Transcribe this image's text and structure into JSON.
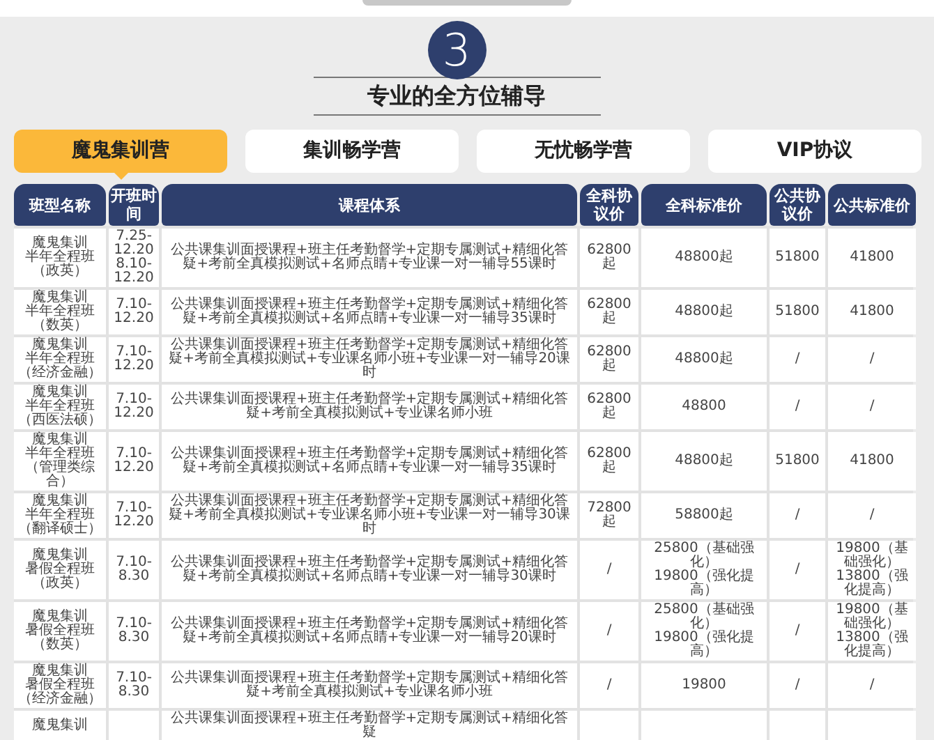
{
  "step_number": "3",
  "section_title": "专业的全方位辅导",
  "tabs": [
    {
      "label": "魔鬼集训营",
      "selected": true
    },
    {
      "label": "集训畅学营",
      "selected": false
    },
    {
      "label": "无忧畅学营",
      "selected": false
    },
    {
      "label": "VIP协议",
      "selected": false
    }
  ],
  "table": {
    "columns": [
      "班型名称",
      "开班时间",
      "课程体系",
      "全科协议价",
      "全科标准价",
      "公共协议价",
      "公共标准价"
    ],
    "rows": [
      {
        "name": [
          "魔鬼集训",
          "半年全程班（政英）"
        ],
        "dates": [
          "7.25-12.20",
          "8.10-12.20"
        ],
        "course": "公共课集训面授课程+班主任考勤督学+定期专属测试+精细化答疑+考前全真模拟测试+名师点睛+专业课一对一辅导55课时",
        "full_agreement": [
          "62800起"
        ],
        "full_standard": [
          "48800起"
        ],
        "public_agreement": [
          "51800"
        ],
        "public_standard": [
          "41800"
        ]
      },
      {
        "name": [
          "魔鬼集训",
          "半年全程班（数英）"
        ],
        "dates": [
          "7.10-12.20"
        ],
        "course": "公共课集训面授课程+班主任考勤督学+定期专属测试+精细化答疑+考前全真模拟测试+名师点睛+专业课一对一辅导35课时",
        "full_agreement": [
          "62800起"
        ],
        "full_standard": [
          "48800起"
        ],
        "public_agreement": [
          "51800"
        ],
        "public_standard": [
          "41800"
        ]
      },
      {
        "name": [
          "魔鬼集训",
          "半年全程班（经济金融）"
        ],
        "dates": [
          "7.10-12.20"
        ],
        "course": "公共课集训面授课程+班主任考勤督学+定期专属测试+精细化答疑+考前全真模拟测试+专业课名师小班+专业课一对一辅导20课时",
        "full_agreement": [
          "62800起"
        ],
        "full_standard": [
          "48800起"
        ],
        "public_agreement": [
          "/"
        ],
        "public_standard": [
          "/"
        ]
      },
      {
        "name": [
          "魔鬼集训",
          "半年全程班（西医法硕）"
        ],
        "dates": [
          "7.10-12.20"
        ],
        "course": "公共课集训面授课程+班主任考勤督学+定期专属测试+精细化答疑+考前全真模拟测试+专业课名师小班",
        "full_agreement": [
          "62800起"
        ],
        "full_standard": [
          "48800"
        ],
        "public_agreement": [
          "/"
        ],
        "public_standard": [
          "/"
        ]
      },
      {
        "name": [
          "魔鬼集训",
          "半年全程班（管理类综合）"
        ],
        "dates": [
          "7.10-12.20"
        ],
        "course": "公共课集训面授课程+班主任考勤督学+定期专属测试+精细化答疑+考前全真模拟测试+名师点睛+专业课一对一辅导35课时",
        "full_agreement": [
          "62800起"
        ],
        "full_standard": [
          "48800起"
        ],
        "public_agreement": [
          "51800"
        ],
        "public_standard": [
          "41800"
        ]
      },
      {
        "name": [
          "魔鬼集训",
          "半年全程班（翻译硕士）"
        ],
        "dates": [
          "7.10-12.20"
        ],
        "course": "公共课集训面授课程+班主任考勤督学+定期专属测试+精细化答疑+考前全真模拟测试+专业课名师小班+专业课一对一辅导30课时",
        "full_agreement": [
          "72800起"
        ],
        "full_standard": [
          "58800起"
        ],
        "public_agreement": [
          "/"
        ],
        "public_standard": [
          "/"
        ]
      },
      {
        "name": [
          "魔鬼集训",
          "暑假全程班（政英）"
        ],
        "dates": [
          "7.10-8.30"
        ],
        "course": "公共课集训面授课程+班主任考勤督学+定期专属测试+精细化答疑+考前全真模拟测试+名师点睛+专业课一对一辅导30课时",
        "full_agreement": [
          "/"
        ],
        "full_standard": [
          "25800（基础强化）",
          "19800（强化提高）"
        ],
        "public_agreement": [
          "/"
        ],
        "public_standard": [
          "19800（基础强化）",
          "13800（强化提高）"
        ]
      },
      {
        "name": [
          "魔鬼集训",
          "暑假全程班（数英）"
        ],
        "dates": [
          "7.10-8.30"
        ],
        "course": "公共课集训面授课程+班主任考勤督学+定期专属测试+精细化答疑+考前全真模拟测试+名师点睛+专业课一对一辅导20课时",
        "full_agreement": [
          "/"
        ],
        "full_standard": [
          "25800（基础强化）",
          "19800（强化提高）"
        ],
        "public_agreement": [
          "/"
        ],
        "public_standard": [
          "19800（基础强化）",
          "13800（强化提高）"
        ]
      },
      {
        "name": [
          "魔鬼集训",
          "暑假全程班（经济金融）"
        ],
        "dates": [
          "7.10-8.30"
        ],
        "course": "公共课集训面授课程+班主任考勤督学+定期专属测试+精细化答疑+考前全真模拟测试+专业课名师小班",
        "full_agreement": [
          "/"
        ],
        "full_standard": [
          "19800"
        ],
        "public_agreement": [
          "/"
        ],
        "public_standard": [
          "/"
        ]
      },
      {
        "name": [
          "魔鬼集训"
        ],
        "dates": [],
        "course": "公共课集训面授课程+班主任考勤督学+定期专属测试+精细化答疑",
        "full_agreement": [],
        "full_standard": [],
        "public_agreement": [],
        "public_standard": []
      }
    ]
  }
}
